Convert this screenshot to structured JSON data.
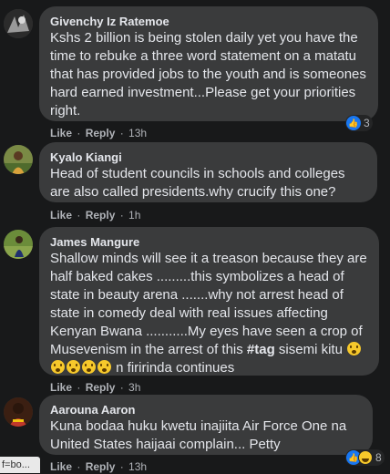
{
  "comments": [
    {
      "author": "Givenchy Iz Ratemoe",
      "text": "Kshs 2 billion is being stolen daily yet you have the time to rebuke a three word statement on a matatu that has provided jobs to the youth and is someones hard earned investment...Please get your priorities right.",
      "like": "Like",
      "reply": "Reply",
      "time": "13h",
      "reaction_count": "3"
    },
    {
      "author": "Kyalo Kiangi",
      "text": "Head of student councils in schools and colleges are also called presidents.why crucify this one?",
      "like": "Like",
      "reply": "Reply",
      "time": "1h"
    },
    {
      "author": "James Mangure",
      "text_part1": "Shallow minds will see it a treason because they are half baked cakes .........this symbolizes a head of state in beauty arena .......why not arrest head of state in comedy deal with real issues affecting Kenyan Bwana ...........My eyes have seen a crop of Musevenism in the arrest of this ",
      "tag": "#tag",
      "text_part2": " sisemi kitu ",
      "text_part3": " n firirinda continues",
      "like": "Like",
      "reply": "Reply",
      "time": "3h"
    },
    {
      "author": "Aarouna Aaron",
      "text": "Kuna bodaa huku kwetu inajiita Air Force One na United States haijaai complain... Petty",
      "like": "Like",
      "reply": "Reply",
      "time": "13h",
      "reaction_count": "8"
    }
  ],
  "status_url": "f=bo..."
}
